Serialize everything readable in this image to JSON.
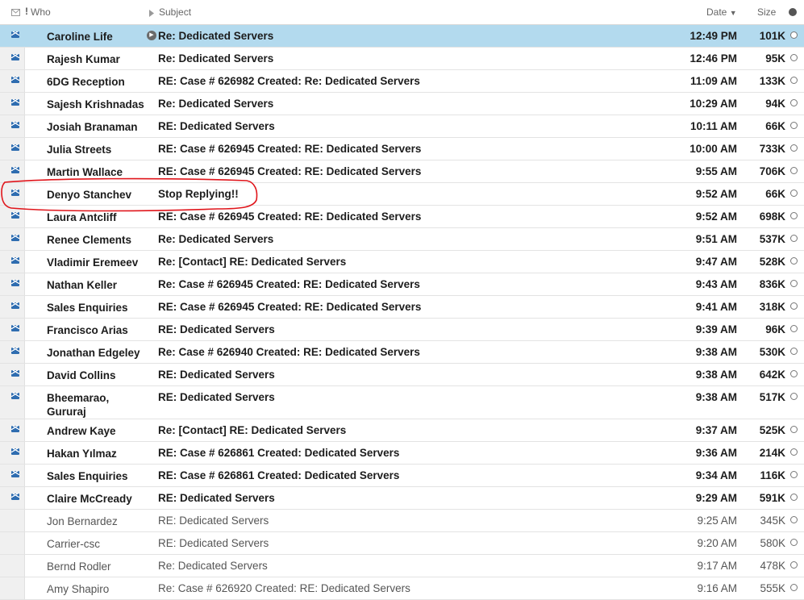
{
  "header": {
    "who": "Who",
    "important_mark": "!",
    "subject": "Subject",
    "date": "Date",
    "date_sort": "▼",
    "size": "Size"
  },
  "colors": {
    "selected_row": "#b3daee",
    "envelope": "#2f6db0",
    "annotation": "#e0151b"
  },
  "icons": {
    "unread": "envelope-icon",
    "thread": "thread-play-icon",
    "status": "status-circle-icon"
  },
  "rows": [
    {
      "who": "Caroline Life",
      "subject": "Re: Dedicated Servers",
      "date": "12:49 PM",
      "size": "101K",
      "unread": true,
      "selected": true,
      "thread": true
    },
    {
      "who": "Rajesh Kumar",
      "subject": "Re: Dedicated Servers",
      "date": "12:46 PM",
      "size": "95K",
      "unread": true
    },
    {
      "who": "6DG Reception",
      "subject": "RE: Case # 626982 Created: Re: Dedicated Servers",
      "date": "11:09 AM",
      "size": "133K",
      "unread": true
    },
    {
      "who": "Sajesh Krishnadas",
      "subject": "Re: Dedicated Servers",
      "date": "10:29 AM",
      "size": "94K",
      "unread": true
    },
    {
      "who": "Josiah Branaman",
      "subject": "RE: Dedicated Servers",
      "date": "10:11 AM",
      "size": "66K",
      "unread": true
    },
    {
      "who": "Julia Streets",
      "subject": "RE: Case # 626945 Created: RE: Dedicated Servers",
      "date": "10:00 AM",
      "size": "733K",
      "unread": true
    },
    {
      "who": "Martin Wallace",
      "subject": "RE: Case # 626945 Created: RE: Dedicated Servers",
      "date": "9:55 AM",
      "size": "706K",
      "unread": true
    },
    {
      "who": "Denyo Stanchev",
      "subject": "Stop Replying!!",
      "date": "9:52 AM",
      "size": "66K",
      "unread": true,
      "annotated": true
    },
    {
      "who": "Laura Antcliff",
      "subject": "RE: Case # 626945 Created: RE: Dedicated Servers",
      "date": "9:52 AM",
      "size": "698K",
      "unread": true
    },
    {
      "who": "Renee Clements",
      "subject": "Re: Dedicated Servers",
      "date": "9:51 AM",
      "size": "537K",
      "unread": true
    },
    {
      "who": "Vladimir Eremeev",
      "subject": "Re: [Contact] RE: Dedicated Servers",
      "date": "9:47 AM",
      "size": "528K",
      "unread": true
    },
    {
      "who": "Nathan Keller",
      "subject": "Re: Case # 626945 Created: RE: Dedicated Servers",
      "date": "9:43 AM",
      "size": "836K",
      "unread": true
    },
    {
      "who": "Sales Enquiries",
      "subject": "RE: Case # 626945 Created: RE: Dedicated Servers",
      "date": "9:41 AM",
      "size": "318K",
      "unread": true
    },
    {
      "who": "Francisco Arias",
      "subject": "RE: Dedicated Servers",
      "date": "9:39 AM",
      "size": "96K",
      "unread": true
    },
    {
      "who": "Jonathan Edgeley",
      "subject": "Re: Case # 626940 Created: RE: Dedicated Servers",
      "date": "9:38 AM",
      "size": "530K",
      "unread": true
    },
    {
      "who": "David Collins",
      "subject": "RE: Dedicated Servers",
      "date": "9:38 AM",
      "size": "642K",
      "unread": true
    },
    {
      "who": "Bheemarao, Gururaj",
      "subject": "RE: Dedicated Servers",
      "date": "9:38 AM",
      "size": "517K",
      "unread": true,
      "tall": true
    },
    {
      "who": "Andrew Kaye",
      "subject": "Re: [Contact] RE: Dedicated Servers",
      "date": "9:37 AM",
      "size": "525K",
      "unread": true
    },
    {
      "who": "Hakan Yılmaz",
      "subject": "RE: Case # 626861 Created: Dedicated Servers",
      "date": "9:36 AM",
      "size": "214K",
      "unread": true
    },
    {
      "who": "Sales Enquiries",
      "subject": "RE: Case # 626861 Created: Dedicated Servers",
      "date": "9:34 AM",
      "size": "116K",
      "unread": true
    },
    {
      "who": "Claire McCready",
      "subject": "RE: Dedicated Servers",
      "date": "9:29 AM",
      "size": "591K",
      "unread": true
    },
    {
      "who": "Jon Bernardez",
      "subject": "RE: Dedicated Servers",
      "date": "9:25 AM",
      "size": "345K",
      "unread": false
    },
    {
      "who": "Carrier-csc",
      "subject": "RE: Dedicated Servers",
      "date": "9:20 AM",
      "size": "580K",
      "unread": false
    },
    {
      "who": "Bernd Rodler",
      "subject": "Re: Dedicated Servers",
      "date": "9:17 AM",
      "size": "478K",
      "unread": false
    },
    {
      "who": "Amy Shapiro",
      "subject": "Re: Case # 626920 Created: RE: Dedicated Servers",
      "date": "9:16 AM",
      "size": "555K",
      "unread": false
    }
  ]
}
